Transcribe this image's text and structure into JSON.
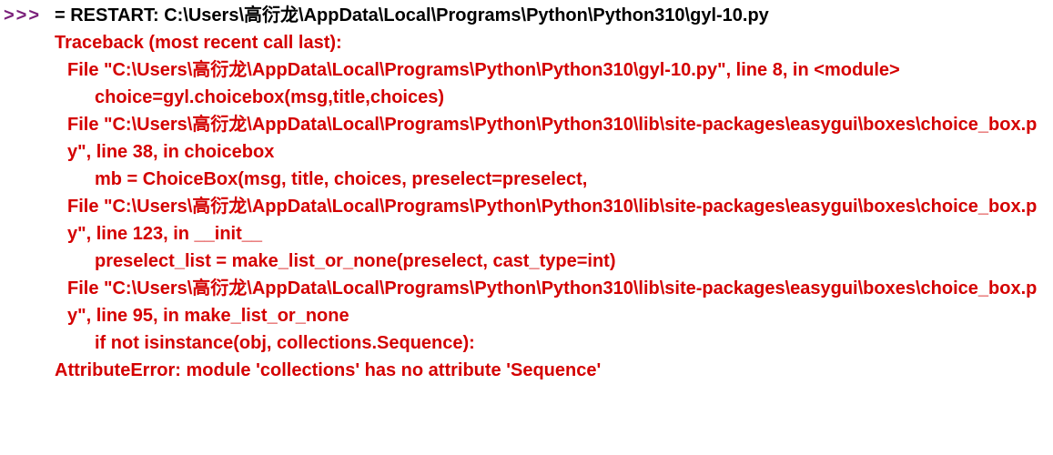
{
  "prompt": ">>>",
  "restart_prefix": "= RESTART: ",
  "restart_path": "C:\\Users\\高衍龙\\AppData\\Local\\Programs\\Python\\Python310\\gyl-10.py",
  "traceback": {
    "header": "Traceback (most recent call last):",
    "frames": [
      {
        "location": "  File \"C:\\Users\\高衍龙\\AppData\\Local\\Programs\\Python\\Python310\\gyl-10.py\", line 8, in <module>",
        "code": "choice=gyl.choicebox(msg,title,choices)"
      },
      {
        "location": "  File \"C:\\Users\\高衍龙\\AppData\\Local\\Programs\\Python\\Python310\\lib\\site-packages\\easygui\\boxes\\choice_box.py\", line 38, in choicebox",
        "code": "mb = ChoiceBox(msg, title, choices, preselect=preselect,"
      },
      {
        "location": "  File \"C:\\Users\\高衍龙\\AppData\\Local\\Programs\\Python\\Python310\\lib\\site-packages\\easygui\\boxes\\choice_box.py\", line 123, in __init__",
        "code": "preselect_list = make_list_or_none(preselect, cast_type=int)"
      },
      {
        "location": "  File \"C:\\Users\\高衍龙\\AppData\\Local\\Programs\\Python\\Python310\\lib\\site-packages\\easygui\\boxes\\choice_box.py\", line 95, in make_list_or_none",
        "code": "if not isinstance(obj, collections.Sequence):"
      }
    ],
    "error": "AttributeError: module 'collections' has no attribute 'Sequence'"
  }
}
